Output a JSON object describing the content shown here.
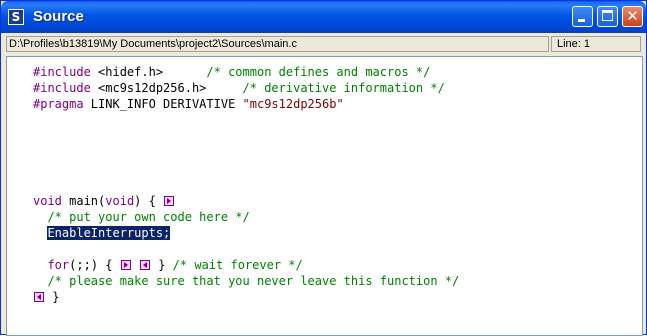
{
  "window": {
    "title": "Source",
    "icon_letter": "S"
  },
  "pathbar": {
    "path": "D:\\Profiles\\b13819\\My Documents\\project2\\Sources\\main.c",
    "line": "Line: 1"
  },
  "code": {
    "l1_kw": "#include",
    "l1_rest": " <hidef.h>      ",
    "l1_cm": "/* common defines and macros */",
    "l2_kw": "#include",
    "l2_rest": " <mc9s12dp256.h>     ",
    "l2_cm": "/* derivative information */",
    "l3_kw": "#pragma",
    "l3_rest": " LINK_INFO DERIVATIVE ",
    "l3_str": "\"mc9s12dp256b\"",
    "l4_kw": "void",
    "l4_rest": " main(",
    "l4_kw2": "void",
    "l4_rest2": ") {",
    "l5_cm": "/* put your own code here */",
    "l6_sel": "EnableInterrupts;",
    "l7_kw": "for",
    "l7_rest": "(;;) {",
    "l7_rest2": "}",
    "l7_cm": "/* wait forever */",
    "l8_cm": "/* please make sure that you never leave this function */",
    "l9_rest": "}"
  },
  "colors": {
    "keyword": "#800080",
    "comment": "#008000",
    "string": "#800000",
    "selection": "#0a246a"
  }
}
